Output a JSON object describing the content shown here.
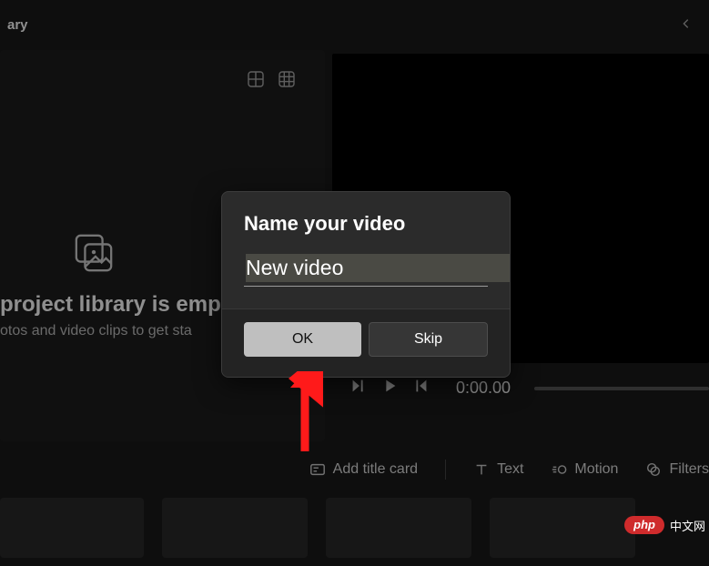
{
  "header": {
    "title_fragment": "ary"
  },
  "library": {
    "heading": " project library is empt",
    "subtext": "otos and video clips to get sta"
  },
  "player": {
    "time": "0:00.00"
  },
  "toolbar": {
    "add_title_card": "Add title card",
    "text": "Text",
    "motion": "Motion",
    "filters": "Filters"
  },
  "dialog": {
    "title": "Name your video",
    "input_value": "New video",
    "ok": "OK",
    "skip": "Skip"
  },
  "watermark": {
    "brand": "php",
    "text": "中文网"
  }
}
